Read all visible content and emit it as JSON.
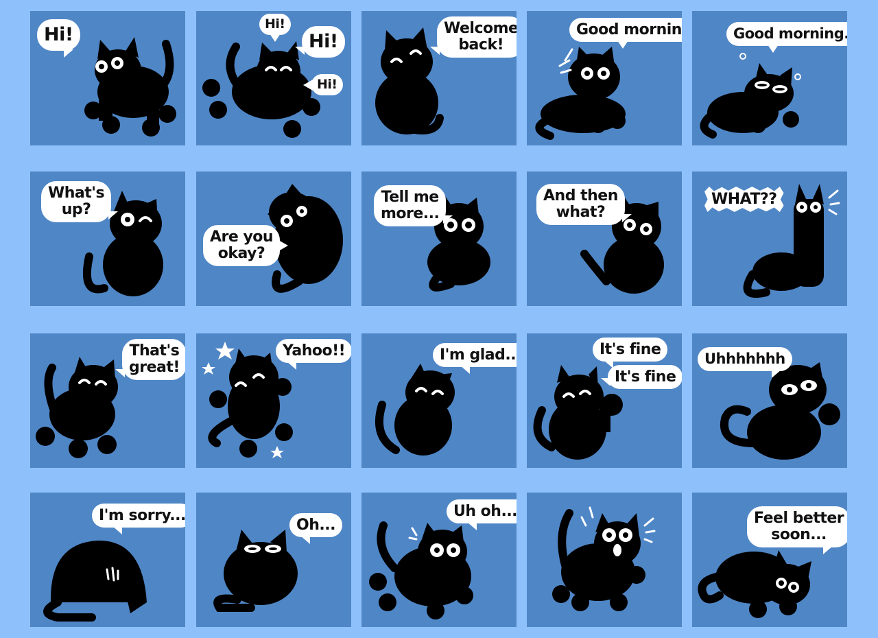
{
  "colors": {
    "background": "#8ec1fb",
    "tile": "#4f86c6",
    "cat": "#000000",
    "bubble": "#ffffff",
    "text": "#111111"
  },
  "stickers": [
    {
      "id": "hi",
      "bubbles": [
        "Hi!"
      ]
    },
    {
      "id": "hi-hi-hi",
      "bubbles": [
        "Hi!",
        "Hi!",
        "Hi!"
      ]
    },
    {
      "id": "welcome-back",
      "bubbles": [
        "Welcome",
        "back!"
      ]
    },
    {
      "id": "good-morning",
      "bubbles": [
        "Good morning!"
      ]
    },
    {
      "id": "good-morning-sleepy",
      "bubbles": [
        "Good morning..."
      ]
    },
    {
      "id": "whats-up",
      "bubbles": [
        "What's",
        "up?"
      ]
    },
    {
      "id": "are-you-okay",
      "bubbles": [
        "Are you",
        "okay?"
      ]
    },
    {
      "id": "tell-me-more",
      "bubbles": [
        "Tell me",
        "more..."
      ]
    },
    {
      "id": "and-then-what",
      "bubbles": [
        "And then",
        "what?"
      ]
    },
    {
      "id": "what",
      "bubbles": [
        "WHAT??"
      ]
    },
    {
      "id": "thats-great",
      "bubbles": [
        "That's",
        "great!"
      ]
    },
    {
      "id": "yahoo",
      "bubbles": [
        "Yahoo!!"
      ]
    },
    {
      "id": "im-glad",
      "bubbles": [
        "I'm glad..."
      ]
    },
    {
      "id": "its-fine",
      "bubbles": [
        "It's fine",
        "It's fine"
      ]
    },
    {
      "id": "uhhh",
      "bubbles": [
        "Uhhhhhhh"
      ]
    },
    {
      "id": "im-sorry",
      "bubbles": [
        "I'm sorry..."
      ]
    },
    {
      "id": "oh",
      "bubbles": [
        "Oh..."
      ]
    },
    {
      "id": "uh-oh",
      "bubbles": [
        "Uh oh...."
      ]
    },
    {
      "id": "surprised",
      "bubbles": []
    },
    {
      "id": "feel-better-soon",
      "bubbles": [
        "Feel better",
        "soon..."
      ]
    }
  ]
}
